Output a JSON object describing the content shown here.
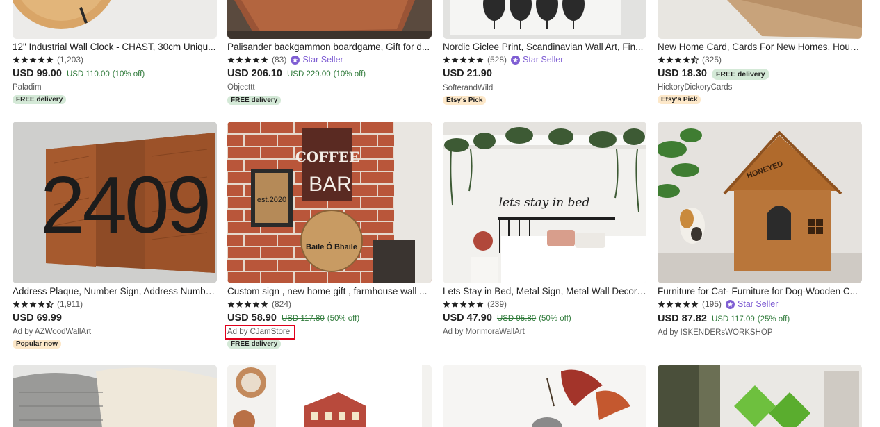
{
  "listings": [
    {
      "title": "12\" Industrial Wall Clock - CHAST, 30cm Uniqu...",
      "stars": 5,
      "rating_count": "(1,203)",
      "star_seller": "",
      "price": "USD 99.00",
      "original_price": "USD 110.00",
      "discount": "(10% off)",
      "free_inline": "",
      "shop": "Paladim",
      "badge": "FREE delivery",
      "badge_type": "free"
    },
    {
      "title": "Palisander backgammon boardgame, Gift for d...",
      "stars": 5,
      "rating_count": "(83)",
      "star_seller": "Star Seller",
      "price": "USD 206.10",
      "original_price": "USD 229.00",
      "discount": "(10% off)",
      "free_inline": "",
      "shop": "Objecttt",
      "badge": "FREE delivery",
      "badge_type": "free"
    },
    {
      "title": "Nordic Giclee Print, Scandinavian Wall Art, Fin...",
      "stars": 5,
      "rating_count": "(528)",
      "star_seller": "Star Seller",
      "price": "USD 21.90",
      "original_price": "",
      "discount": "",
      "free_inline": "",
      "shop": "SofterandWild",
      "badge": "Etsy's Pick",
      "badge_type": "pick"
    },
    {
      "title": "New Home Card, Cards For New Homes, Hous...",
      "stars": 4.5,
      "rating_count": "(325)",
      "star_seller": "",
      "price": "USD 18.30",
      "original_price": "",
      "discount": "",
      "free_inline": "FREE delivery",
      "shop": "HickoryDickoryCards",
      "badge": "Etsy's Pick",
      "badge_type": "pick"
    },
    {
      "title": "Address Plaque, Number Sign, Address Numbe...",
      "stars": 4.5,
      "rating_count": "(1,911)",
      "star_seller": "",
      "price": "USD 69.99",
      "original_price": "",
      "discount": "",
      "free_inline": "",
      "shop": "Ad by AZWoodWallArt",
      "badge": "Popular now",
      "badge_type": "popular",
      "image_text": "2409"
    },
    {
      "title": "Custom sign , new home gift , farmhouse wall ...",
      "stars": 5,
      "rating_count": "(824)",
      "star_seller": "",
      "price": "USD 58.90",
      "original_price": "USD 117.80",
      "discount": "(50% off)",
      "free_inline": "",
      "shop": "Ad by CJamStore",
      "badge": "FREE delivery",
      "badge_type": "free",
      "image_text": [
        "COFFEE",
        "BAR",
        "est.2020",
        "Baile Ó Bhaile"
      ]
    },
    {
      "title": "Lets Stay in Bed, Metal Sign, Metal Wall Decora...",
      "stars": 5,
      "rating_count": "(239)",
      "star_seller": "",
      "price": "USD 47.90",
      "original_price": "USD 95.80",
      "discount": "(50% off)",
      "free_inline": "",
      "shop": "Ad by MorimoraWallArt",
      "badge": "",
      "badge_type": "",
      "image_text": "lets stay in bed"
    },
    {
      "title": "Furniture for Cat- Furniture for Dog-Wooden C...",
      "stars": 5,
      "rating_count": "(195)",
      "star_seller": "Star Seller",
      "price": "USD 87.82",
      "original_price": "USD 117.09",
      "discount": "(25% off)",
      "free_inline": "",
      "shop": "Ad by ISKENDERsWORKSHOP",
      "badge": "",
      "badge_type": "",
      "image_text": "HONEYED"
    }
  ],
  "colors": {
    "star": "#222222",
    "star_seller": "#7f5ed3",
    "discount_green": "#2f7a3a",
    "highlight": "#e0001b"
  },
  "highlighted_shop": "Ad by CJamStore"
}
